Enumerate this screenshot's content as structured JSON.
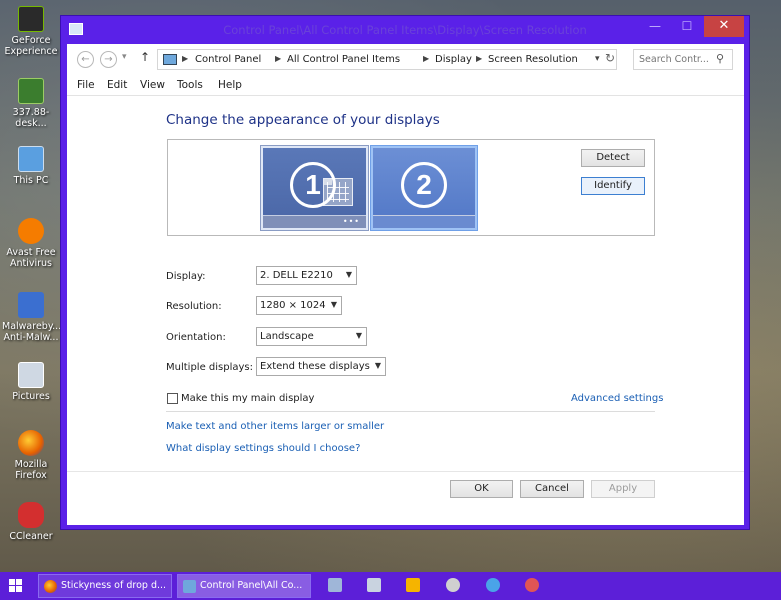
{
  "desktop": {
    "icons": [
      {
        "label": "GeForce Experience",
        "color": "#2a2a2a"
      },
      {
        "label": "337.88-desk...",
        "color": "#4caf50"
      },
      {
        "label": "This PC",
        "color": "#5a9fe0"
      },
      {
        "label": "Avast Free Antivirus",
        "color": "#f57c00"
      },
      {
        "label": "Malwareby... Anti-Malw...",
        "color": "#3b6fd0"
      },
      {
        "label": "Pictures",
        "color": "#cfd8e3"
      },
      {
        "label": "Mozilla Firefox",
        "color": "#e66000"
      },
      {
        "label": "CCleaner",
        "color": "#d32f2f"
      }
    ]
  },
  "window": {
    "title": "Control Panel\\All Control Panel Items\\Display\\Screen Resolution",
    "minimize": "—",
    "maximize": "☐",
    "close": "✕"
  },
  "address": {
    "back": "←",
    "forward": "→",
    "up": "↑",
    "breadcrumbs": [
      "Control Panel",
      "All Control Panel Items",
      "Display",
      "Screen Resolution"
    ],
    "search_placeholder": "Search Contr...",
    "search_icon": "search-icon"
  },
  "menu": [
    "File",
    "Edit",
    "View",
    "Tools",
    "Help"
  ],
  "page": {
    "heading": "Change the appearance of your displays",
    "monitors": [
      {
        "number": "1",
        "selected": false
      },
      {
        "number": "2",
        "selected": true
      }
    ],
    "detect": "Detect",
    "identify": "Identify",
    "fields": {
      "display_label": "Display:",
      "display_value": "2. DELL E2210",
      "resolution_label": "Resolution:",
      "resolution_value": "1280 × 1024",
      "orientation_label": "Orientation:",
      "orientation_value": "Landscape",
      "multiple_label": "Multiple displays:",
      "multiple_value": "Extend these displays"
    },
    "main_display_label": "Make this my main display",
    "main_display_checked": false,
    "advanced_settings": "Advanced settings",
    "link_larger": "Make text and other items larger or smaller",
    "link_which": "What display settings should I choose?",
    "ok": "OK",
    "cancel": "Cancel",
    "apply": "Apply"
  },
  "taskbar": {
    "buttons": [
      {
        "label": "Stickyness of drop d...",
        "color": "#e66000"
      },
      {
        "label": "Control Panel\\All Co...",
        "color": "#6fa8dc"
      }
    ],
    "pinned": [
      "#9fb6d8",
      "#c9d3e0",
      "#f5b400",
      "#d0d0d0",
      "#4aa3e8",
      "#e05555"
    ],
    "colors": {
      "accent": "#5a21e8",
      "link": "#1a5fb4",
      "heading": "#1e3287"
    }
  }
}
